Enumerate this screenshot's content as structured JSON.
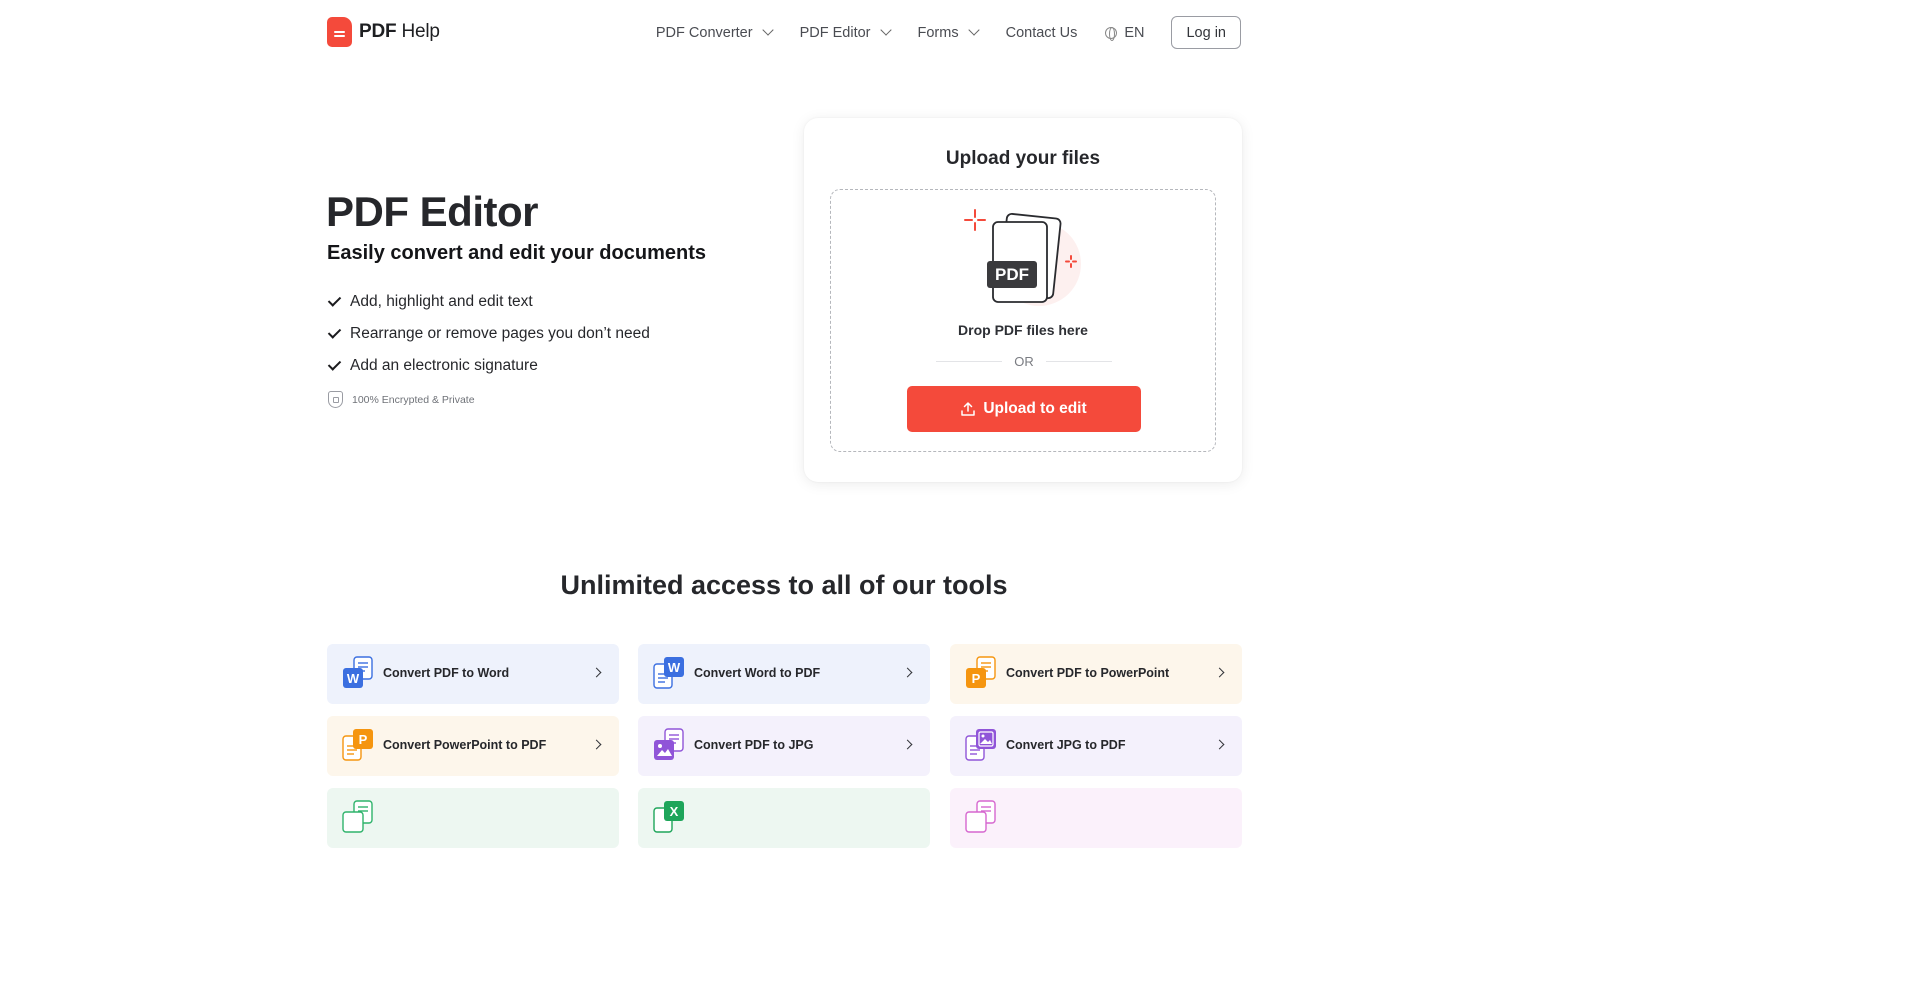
{
  "header": {
    "logo_bold": "PDF",
    "logo_rest": " Help",
    "nav": [
      "PDF Converter",
      "PDF Editor",
      "Forms",
      "Contact Us"
    ],
    "language": "EN",
    "login_label": "Log in"
  },
  "hero": {
    "title": "PDF Editor",
    "subtitle": "Easily convert and edit your documents",
    "features": [
      "Add, highlight and edit text",
      "Rearrange or remove pages you don’t need",
      "Add an electronic signature"
    ],
    "security_note": "100% Encrypted & Private"
  },
  "upload": {
    "title": "Upload your files",
    "badge": "PDF",
    "drop_text": "Drop PDF files here",
    "or_text": "OR",
    "button_label": "Upload to edit"
  },
  "tools": {
    "title": "Unlimited access to all of our tools",
    "items": [
      {
        "label": "Convert PDF to Word",
        "letter": "W",
        "color": "#3b6fe0"
      },
      {
        "label": "Convert Word to PDF",
        "letter": "W",
        "color": "#3b6fe0"
      },
      {
        "label": "Convert PDF to PowerPoint",
        "letter": "P",
        "color": "#f5950f"
      },
      {
        "label": "Convert PowerPoint to PDF",
        "letter": "P",
        "color": "#f5950f"
      },
      {
        "label": "Convert PDF to JPG",
        "letter": "",
        "color": "#9055d8"
      },
      {
        "label": "Convert JPG to PDF",
        "letter": "",
        "color": "#9055d8"
      },
      {
        "label": "",
        "letter": "",
        "color": "#2fb36b"
      },
      {
        "label": "",
        "letter": "X",
        "color": "#1ea55a"
      },
      {
        "label": "",
        "letter": "",
        "color": "#d667cf"
      }
    ]
  },
  "colors": {
    "accent": "#f44a3b",
    "text": "#26272b"
  }
}
